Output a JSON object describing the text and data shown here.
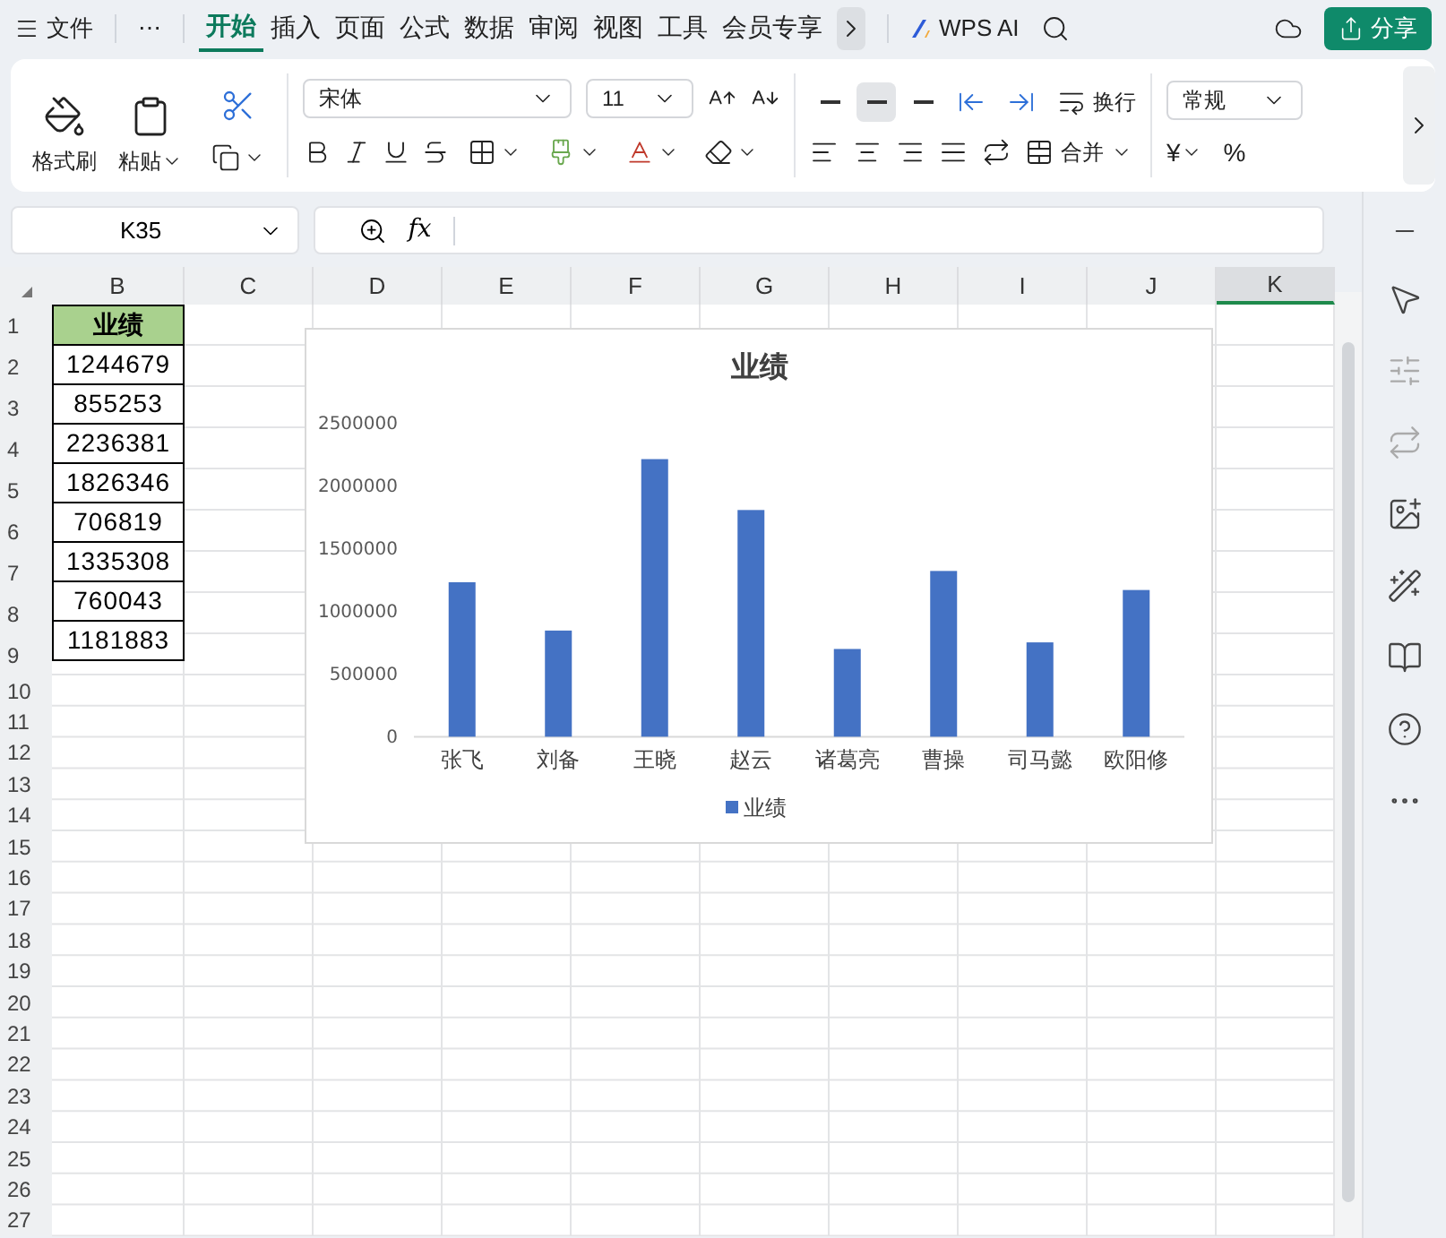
{
  "menu_bar": {
    "file": "文件",
    "more": "⋯",
    "tabs": [
      {
        "label": "开始",
        "selected": true
      },
      {
        "label": "插入",
        "selected": false
      },
      {
        "label": "页面",
        "selected": false
      },
      {
        "label": "公式",
        "selected": false
      },
      {
        "label": "数据",
        "selected": false
      },
      {
        "label": "审阅",
        "selected": false
      },
      {
        "label": "视图",
        "selected": false
      },
      {
        "label": "工具",
        "selected": false
      },
      {
        "label": "会员专享",
        "selected": false
      }
    ],
    "ai": "WPS AI",
    "share": "分享"
  },
  "ribbon": {
    "format_painter": "格式刷",
    "paste": "粘贴",
    "font": "宋体",
    "font_size": "11",
    "vertical_align": [
      {
        "selected": false
      },
      {
        "selected": true
      },
      {
        "selected": false
      }
    ],
    "wrap": "换行",
    "merge": "合并",
    "number_format": "常规",
    "currency": "¥",
    "percent": "%"
  },
  "formula_bar": {
    "name_box": "K35",
    "fx": "fx"
  },
  "sheet": {
    "columns": [
      {
        "label": "B",
        "selected": false
      },
      {
        "label": "C",
        "selected": false
      },
      {
        "label": "D",
        "selected": false
      },
      {
        "label": "E",
        "selected": false
      },
      {
        "label": "F",
        "selected": false
      },
      {
        "label": "G",
        "selected": false
      },
      {
        "label": "H",
        "selected": false
      },
      {
        "label": "I",
        "selected": false
      },
      {
        "label": "J",
        "selected": false
      },
      {
        "label": "K",
        "selected": true
      }
    ],
    "rows": [
      "1",
      "2",
      "3",
      "4",
      "5",
      "6",
      "7",
      "8",
      "9",
      "10",
      "11",
      "12",
      "13",
      "14",
      "15",
      "16",
      "17",
      "18",
      "19",
      "20",
      "21",
      "22",
      "23",
      "24",
      "25",
      "26",
      "27"
    ],
    "column_b": [
      {
        "text": "业绩",
        "kind": "header"
      },
      {
        "text": "1244679",
        "kind": "value"
      },
      {
        "text": "855253",
        "kind": "value"
      },
      {
        "text": "2236381",
        "kind": "value"
      },
      {
        "text": "1826346",
        "kind": "value"
      },
      {
        "text": "706819",
        "kind": "value"
      },
      {
        "text": "1335308",
        "kind": "value"
      },
      {
        "text": "760043",
        "kind": "value"
      },
      {
        "text": "1181883",
        "kind": "value"
      }
    ],
    "chart": {
      "chart_data": {
        "type": "bar",
        "title": "业绩",
        "categories": [
          "张飞",
          "刘备",
          "王晓",
          "赵云",
          "诸葛亮",
          "曹操",
          "司马懿",
          "欧阳修"
        ],
        "series": [
          {
            "name": "业绩",
            "color": "#4472c4",
            "values": [
              1244679,
              855253,
              2236381,
              1826346,
              706819,
              1335308,
              760043,
              1181883
            ]
          }
        ],
        "ylim": [
          0,
          2500000
        ],
        "yticks": [
          0,
          500000,
          1000000,
          1500000,
          2000000,
          2500000
        ]
      }
    }
  }
}
